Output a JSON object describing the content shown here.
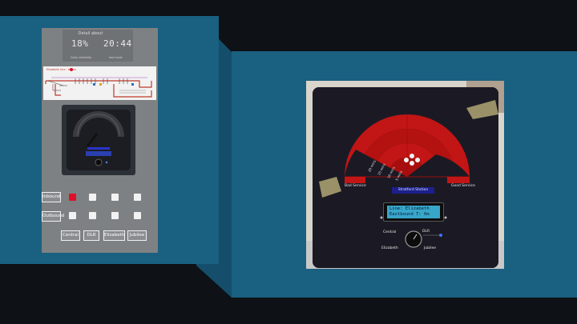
{
  "phone": {
    "header_title": "Detail about",
    "percent_value": "18%",
    "percent_label": "Daily reliability",
    "time_value": "20:44",
    "time_label": "last trade",
    "map_title": "Elizabeth line - trains",
    "rows": [
      {
        "label": "Inbound",
        "active_index": 0
      },
      {
        "label": "Outbound",
        "active_index": -1
      }
    ],
    "lines": [
      "Central",
      "DLR",
      "Elizabeth",
      "Jubilee"
    ]
  },
  "device": {
    "left_label": "Bad Service",
    "right_label": "Good Service",
    "station": "Stratford Station",
    "lcd_line1": "Line: Elizabeth",
    "lcd_line2": "Eastbound T: 0m",
    "dial_labels": [
      "Central",
      "DLR",
      "Elizabeth",
      "Jubilee"
    ],
    "ring_labels": [
      "20 mins",
      "15 mins",
      "10 mins",
      "5 mins"
    ]
  },
  "colors": {
    "panel": "#1a6080",
    "radar_red": "#c21515",
    "lcd_bg": "#38a6c9",
    "accent_red": "#e0102a"
  }
}
